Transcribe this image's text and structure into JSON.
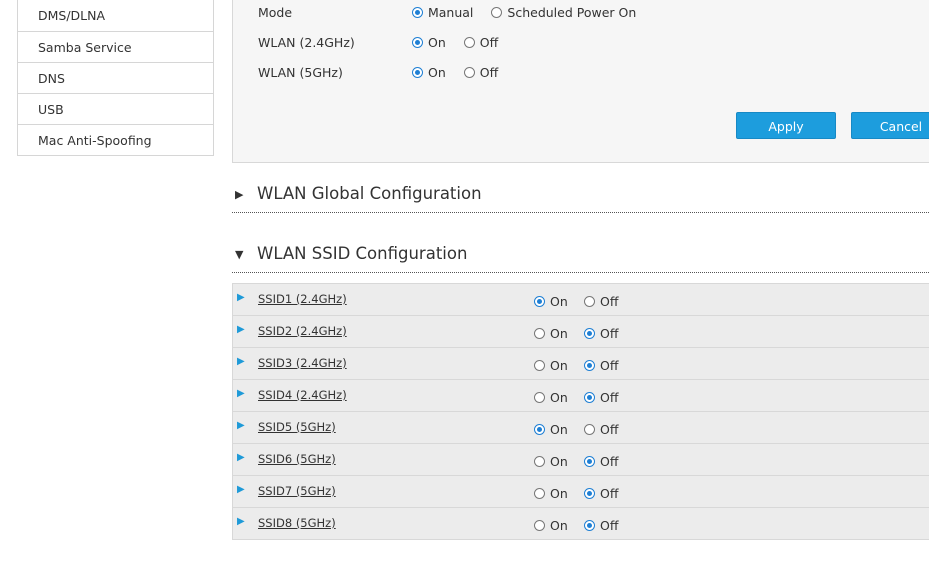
{
  "sidebar": {
    "items": [
      "DMS/DLNA",
      "Samba Service",
      "DNS",
      "USB",
      "Mac Anti-Spoofing"
    ]
  },
  "panel": {
    "mode": {
      "label": "Mode",
      "opt1": "Manual",
      "opt2": "Scheduled Power On",
      "selected": "Manual"
    },
    "wlan24": {
      "label": "WLAN (2.4GHz)",
      "opt1": "On",
      "opt2": "Off",
      "selected": "On"
    },
    "wlan5": {
      "label": "WLAN (5GHz)",
      "opt1": "On",
      "opt2": "Off",
      "selected": "On"
    },
    "apply_label": "Apply",
    "cancel_label": "Cancel"
  },
  "sections": {
    "global": {
      "title": "WLAN Global Configuration",
      "expanded": false
    },
    "ssid": {
      "title": "WLAN SSID Configuration",
      "expanded": true
    }
  },
  "ssid_on_label": "On",
  "ssid_off_label": "Off",
  "ssids": [
    {
      "name": "SSID1 (2.4GHz)",
      "state": "On"
    },
    {
      "name": "SSID2 (2.4GHz)",
      "state": "Off"
    },
    {
      "name": "SSID3 (2.4GHz)",
      "state": "Off"
    },
    {
      "name": "SSID4 (2.4GHz)",
      "state": "Off"
    },
    {
      "name": "SSID5 (5GHz)",
      "state": "On"
    },
    {
      "name": "SSID6 (5GHz)",
      "state": "Off"
    },
    {
      "name": "SSID7 (5GHz)",
      "state": "Off"
    },
    {
      "name": "SSID8 (5GHz)",
      "state": "Off"
    }
  ],
  "colors": {
    "accent": "#1d9ddd",
    "row_bg": "#ececec",
    "panel_bg": "#f6f6f6"
  },
  "icons": {
    "collapsed": "triangle-right-icon",
    "expanded": "triangle-down-icon",
    "row": "expand-arrow-icon"
  }
}
